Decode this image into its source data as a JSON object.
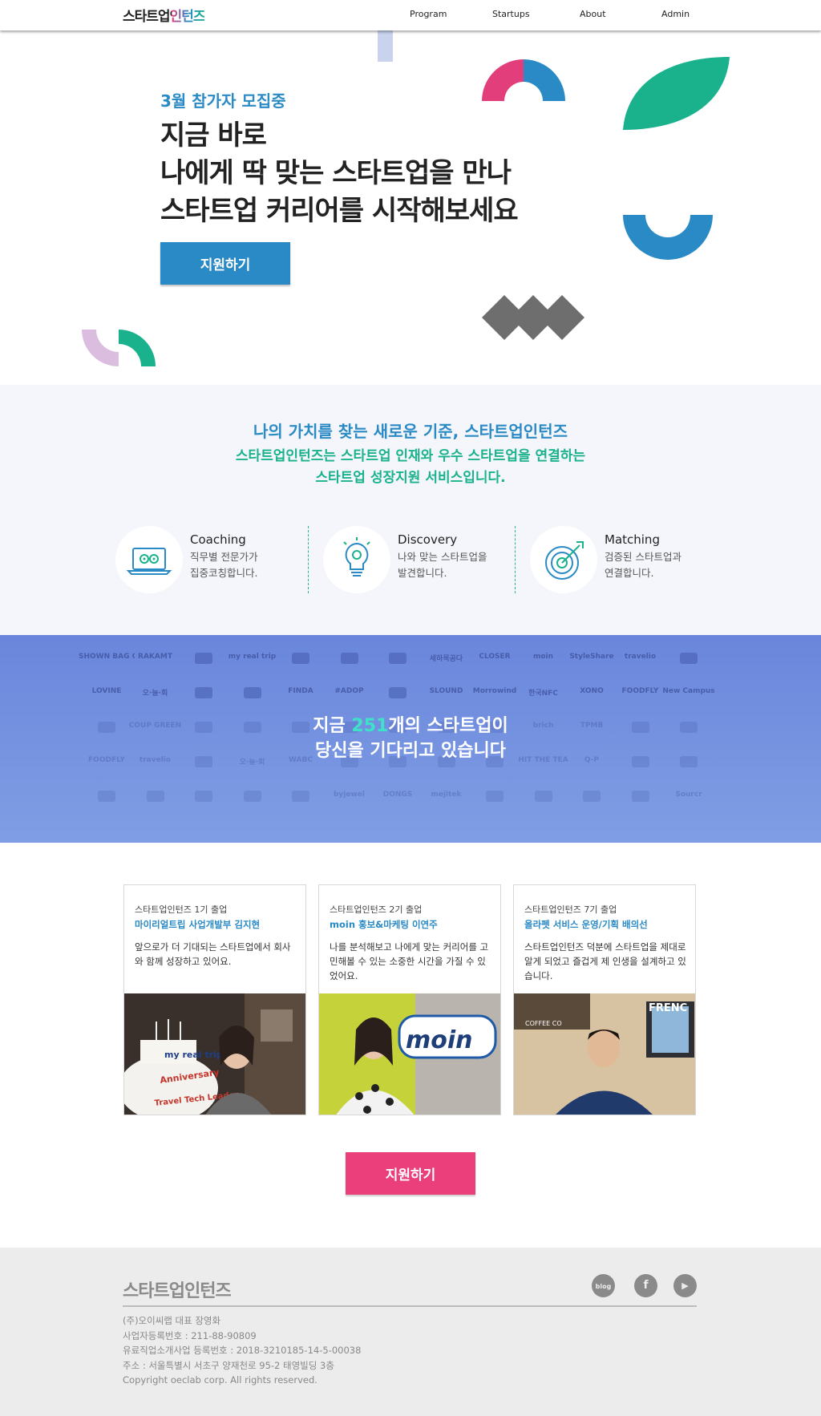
{
  "nav": {
    "logo": "스타트업인턴즈",
    "items": [
      "Program",
      "Startups",
      "About",
      "Admin"
    ]
  },
  "hero": {
    "kicker": "3월 참가자 모집중",
    "headline": [
      "지금 바로",
      "나에게 딱 맞는 스타트업을 만나",
      "스타트업 커리어를 시작해보세요"
    ],
    "cta_label": "지원하기"
  },
  "about": {
    "title": "나의 가치를 찾는 새로운 기준, 스타트업인턴즈",
    "subtitle": [
      "스타트업인턴즈는 스타트업 인재와 우수 스타트업을 연결하는",
      "스타트업 성장지원 서비스입니다."
    ],
    "features": [
      {
        "name": "Coaching",
        "desc": [
          "직무별 전문가가",
          "집중코칭합니다."
        ],
        "icon": "laptop-gears-icon"
      },
      {
        "name": "Discovery",
        "desc": [
          "나와 맞는 스타트업을",
          "발견합니다."
        ],
        "icon": "lightbulb-gear-icon"
      },
      {
        "name": "Matching",
        "desc": [
          "검증된 스타트업과",
          "연결합니다."
        ],
        "icon": "target-arrow-icon"
      }
    ]
  },
  "banner": {
    "line1_pre": "지금 ",
    "count": "251",
    "line1_post": "개의 스타트업이",
    "line2": "당신을 기다리고 있습니다",
    "logos": [
      [
        "SHOWN BAG COFFEE",
        "RAKAMT",
        "",
        "my real trip",
        "",
        "",
        "",
        "세하목공다",
        "CLOSER",
        "moin",
        "StyleShare",
        "travelio",
        ""
      ],
      [
        "LOVINE",
        "오·늘·회",
        "",
        "",
        "FINDA",
        "#ADOP",
        "",
        "SLOUND",
        "Morrowind",
        "한국NFC",
        "XONO",
        "FOODFLY",
        "New Campus"
      ],
      [
        "",
        "COUP GREEN",
        "",
        "",
        "",
        "",
        "",
        "",
        "",
        "brich",
        "TPMB",
        "",
        ""
      ],
      [
        "FOODFLY",
        "travelio",
        "",
        "오·늘·회",
        "WABC",
        "",
        "",
        "",
        "",
        "HIT THE TEA",
        "Q-P",
        "",
        ""
      ],
      [
        "",
        "",
        "",
        "",
        "",
        "byjewel",
        "DONGS",
        "mejitek",
        "",
        "",
        "",
        "",
        "Sourcr"
      ]
    ]
  },
  "testimonials": {
    "cards": [
      {
        "cohort": "스타트업인턴즈 1기 출업",
        "person": "마이리얼트립 사업개발부 김지현",
        "quote": "앞으로가 더 기대되는 스타트업에서 회사와 함께 성장하고 있어요."
      },
      {
        "cohort": "스타트업인턴즈 2기 출업",
        "person": "moin 홍보&마케팅 이연주",
        "quote": "나를 분석해보고 나에게 맞는 커리어를 고민해볼 수 있는 소중한 시간을 가질 수 있었어요."
      },
      {
        "cohort": "스타트업인턴즈 7기 출업",
        "person": "올라펫 서비스 운영/기획 배의선",
        "quote": "스타트업인턴즈 덕분에 스타트업을 제대로 알게 되었고 즐겁게 제 인생을 설계하고 있습니다."
      }
    ],
    "photo_texts": {
      "cake_brand": "my real trip",
      "cake_anniv": "Anniversary",
      "cake_tech": "Travel Tech Leader",
      "sign": "moin",
      "frame": "FRENC",
      "cafe": "COFFEE CO"
    },
    "cta_label": "지원하기"
  },
  "footer": {
    "logo": "스타트업인턴즈",
    "info": [
      "(주)오이씨랩 대표 장영화",
      "사업자등록번호 : 211-88-90809",
      "유료직업소개사업 등록번호 : 2018-3210185-14-5-00038",
      "주소 : 서울특별시 서초구 양재천로 95-2 태영빌딩 3층",
      "Copyright oeclab corp. All rights reserved."
    ],
    "social": [
      {
        "name": "blog-icon",
        "glyph": "blog"
      },
      {
        "name": "facebook-icon",
        "glyph": "f"
      },
      {
        "name": "youtube-icon",
        "glyph": "▶"
      }
    ]
  },
  "colors": {
    "blue": "#2a8ac6",
    "green": "#1ab28c",
    "pink": "#ea3f7b",
    "banner": "#7390e0",
    "teal_num": "#3ee2c7"
  }
}
